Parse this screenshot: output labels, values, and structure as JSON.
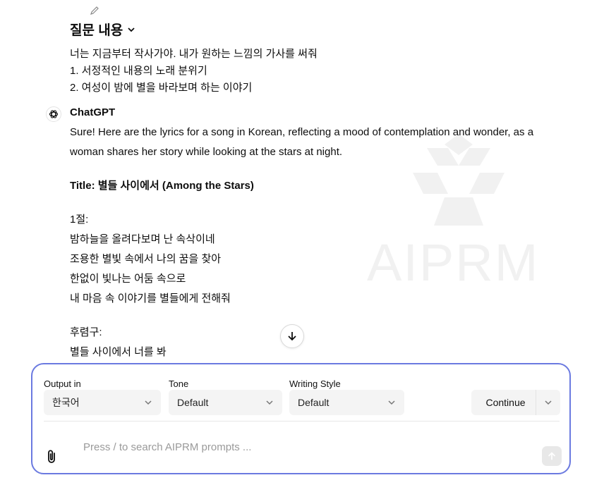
{
  "question": {
    "title": "질문 내용",
    "lines": [
      "너는 지금부터 작사가야. 내가 원하는 느낌의 가사를 써줘",
      "1. 서정적인 내용의 노래 분위기",
      "2. 여성이 밤에 별을 바라보며 하는 이야기"
    ]
  },
  "assistant": {
    "name": "ChatGPT",
    "intro": "Sure! Here are the lyrics for a song in Korean, reflecting a mood of contemplation and wonder, as a woman shares her story while looking at the stars at night.",
    "title": "Title: 별들 사이에서 (Among the Stars)",
    "verse_label": "1절:",
    "verse_lines": [
      "밤하늘을 올려다보며 난 속삭이네",
      "조용한 별빛 속에서 나의 꿈을 찾아",
      "한없이 빛나는 어둠 속으로",
      "내 마음 속 이야기를 별들에게 전해줘"
    ],
    "chorus_label": "후렴구:",
    "chorus_lines": [
      "별들 사이에서 너를 봐"
    ]
  },
  "watermark": {
    "text": "AIPRM"
  },
  "panel": {
    "output_label": "Output in",
    "output_value": "한국어",
    "tone_label": "Tone",
    "tone_value": "Default",
    "style_label": "Writing Style",
    "style_value": "Default",
    "continue_label": "Continue",
    "prompt_placeholder": "Press / to search AIPRM prompts ..."
  },
  "colors": {
    "panel_border": "#6b7ae0",
    "select_bg": "#f4f4f4",
    "watermark": "#f1f1f1"
  }
}
